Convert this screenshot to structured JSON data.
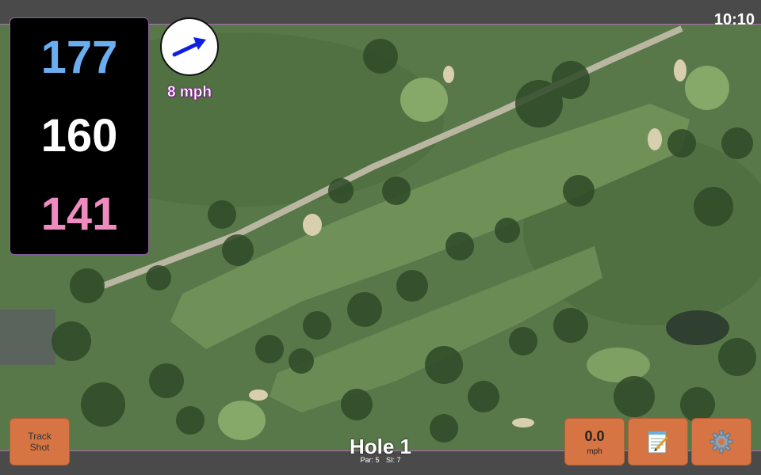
{
  "status": {
    "time": "10:10"
  },
  "yardage": {
    "back": "177",
    "center": "160",
    "front": "141"
  },
  "wind": {
    "speed_label": "8 mph",
    "arrow_icon": "wind-direction-arrow-icon"
  },
  "buttons": {
    "track_shot_line1": "Track",
    "track_shot_line2": "Shot",
    "speed_value": "0.0",
    "speed_unit": "mph",
    "notes_icon": "notepad-icon",
    "settings_icon": "gear-icon"
  },
  "hole": {
    "title": "Hole 1",
    "par_label": "Par: 5",
    "si_label": "SI: 7"
  },
  "colors": {
    "back": "#6aaef0",
    "center": "#ffffff",
    "front": "#f08bc0",
    "button": "#d67543"
  }
}
